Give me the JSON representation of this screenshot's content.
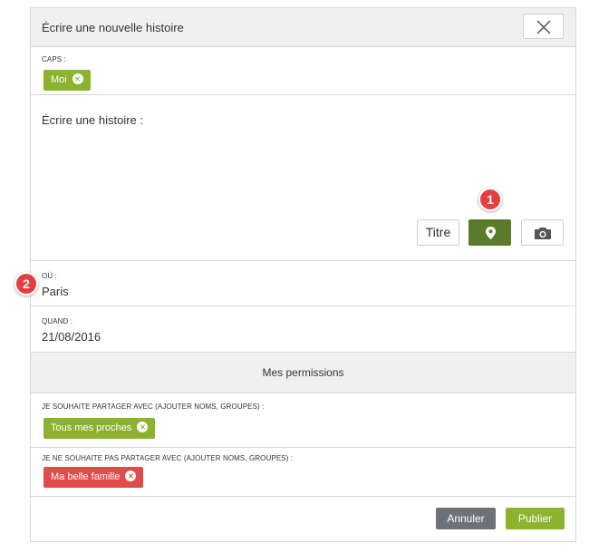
{
  "dialog": {
    "title": "Écrire une nouvelle histoire"
  },
  "caps": {
    "label": "CAPS :",
    "tags": [
      "Moi"
    ]
  },
  "story": {
    "label": "Écrire une histoire :",
    "title_button": "Titre"
  },
  "where": {
    "label": "OÙ :",
    "value": "Paris"
  },
  "when": {
    "label": "QUAND :",
    "value": "21/08/2016"
  },
  "permissions": {
    "header": "Mes permissions",
    "share_label": "JE SOUHAITE PARTAGER AVEC (AJOUTER NOMS, GROUPES) :",
    "share_tags": [
      "Tous mes proches"
    ],
    "noshare_label": "JE NE SOUHAITE PAS PARTAGER AVEC (AJOUTER NOMS, GROUPES) :",
    "noshare_tags": [
      "Ma belle famille"
    ]
  },
  "actions": {
    "cancel": "Annuler",
    "publish": "Publier"
  },
  "markers": {
    "one": "1",
    "two": "2"
  },
  "icons": {
    "close": "close-icon",
    "location": "map-pin-icon",
    "camera": "camera-icon",
    "tag_remove": "remove-circle-icon"
  },
  "colors": {
    "green": "#8bb32d",
    "dark_green": "#5b7a2a",
    "red": "#e34a4a",
    "gray_button": "#6d7278",
    "marker": "#e53e3e"
  }
}
